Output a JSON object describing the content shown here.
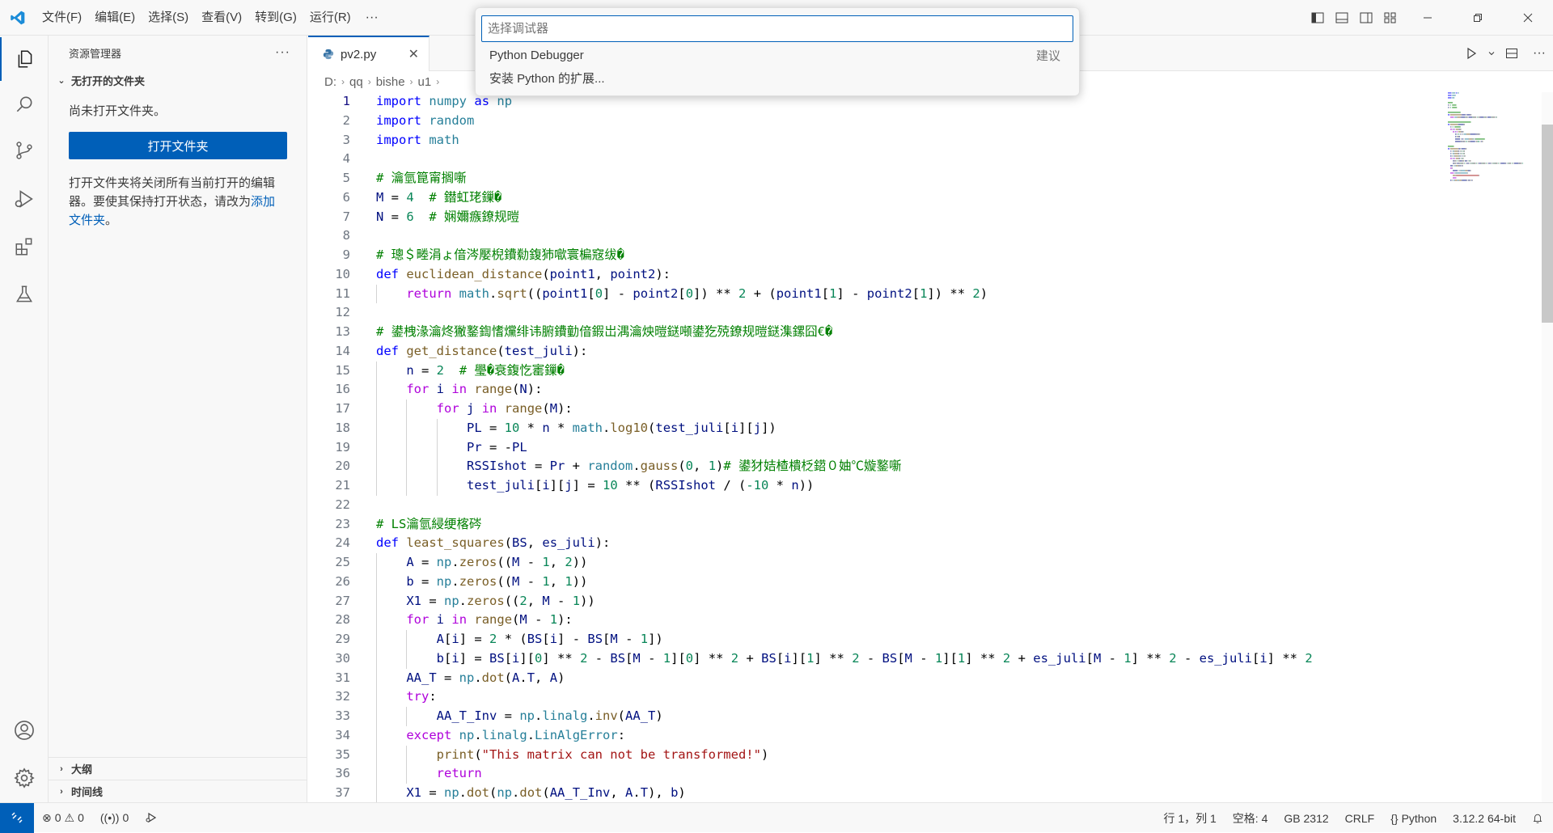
{
  "menu": [
    "文件(F)",
    "编辑(E)",
    "选择(S)",
    "查看(V)",
    "转到(G)",
    "运行(R)"
  ],
  "menu_more": "···",
  "quick_pick": {
    "placeholder": "选择调试器",
    "items": [
      {
        "label": "Python Debugger",
        "hint": "建议"
      },
      {
        "label": "安装 Python 的扩展...",
        "hint": ""
      }
    ]
  },
  "sidebar": {
    "title": "资源管理器",
    "more": "···",
    "section": "无打开的文件夹",
    "no_folder_text": "尚未打开文件夹。",
    "open_button": "打开文件夹",
    "description": "打开文件夹将关闭所有当前打开的编辑器。要使其保持打开状态，请改为",
    "add_link": "添加文件夹",
    "add_suffix": "。",
    "outline": "大纲",
    "timeline": "时间线"
  },
  "tab": {
    "label": "pv2.py",
    "close": "✕"
  },
  "breadcrumb": [
    "D:",
    "qq",
    "bishe",
    "u1"
  ],
  "code_lines": [
    [
      [
        "kw",
        "import"
      ],
      [
        "plain",
        " "
      ],
      [
        "cls",
        "numpy"
      ],
      [
        "plain",
        " "
      ],
      [
        "kw",
        "as"
      ],
      [
        "plain",
        " "
      ],
      [
        "cls",
        "np"
      ]
    ],
    [
      [
        "kw",
        "import"
      ],
      [
        "plain",
        " "
      ],
      [
        "cls",
        "random"
      ]
    ],
    [
      [
        "kw",
        "import"
      ],
      [
        "plain",
        " "
      ],
      [
        "cls",
        "math"
      ]
    ],
    [],
    [
      [
        "com",
        "# 瀹氫箟甯搁噺"
      ]
    ],
    [
      [
        "var",
        "M"
      ],
      [
        "plain",
        " = "
      ],
      [
        "num",
        "4"
      ],
      [
        "plain",
        "  "
      ],
      [
        "com",
        "# 鐟虹珯鏁�"
      ]
    ],
    [
      [
        "var",
        "N"
      ],
      [
        "plain",
        " = "
      ],
      [
        "num",
        "6"
      ],
      [
        "plain",
        "  "
      ],
      [
        "com",
        "# 娴嬭瘯鐐规暟"
      ]
    ],
    [],
    [
      [
        "com",
        "# 璁＄畻涓ょ偣涔嬮棿鐨勬鍑犻噷寰楄窛绂�"
      ]
    ],
    [
      [
        "kw",
        "def"
      ],
      [
        "plain",
        " "
      ],
      [
        "fn",
        "euclidean_distance"
      ],
      [
        "plain",
        "("
      ],
      [
        "var",
        "point1"
      ],
      [
        "plain",
        ", "
      ],
      [
        "var",
        "point2"
      ],
      [
        "plain",
        "):"
      ]
    ],
    [
      [
        "plain",
        "    "
      ],
      [
        "ctrl",
        "return"
      ],
      [
        "plain",
        " "
      ],
      [
        "cls",
        "math"
      ],
      [
        "plain",
        "."
      ],
      [
        "fn",
        "sqrt"
      ],
      [
        "plain",
        "(("
      ],
      [
        "var",
        "point1"
      ],
      [
        "plain",
        "["
      ],
      [
        "num",
        "0"
      ],
      [
        "plain",
        "] - "
      ],
      [
        "var",
        "point2"
      ],
      [
        "plain",
        "["
      ],
      [
        "num",
        "0"
      ],
      [
        "plain",
        "]) ** "
      ],
      [
        "num",
        "2"
      ],
      [
        "plain",
        " + ("
      ],
      [
        "var",
        "point1"
      ],
      [
        "plain",
        "["
      ],
      [
        "num",
        "1"
      ],
      [
        "plain",
        "] - "
      ],
      [
        "var",
        "point2"
      ],
      [
        "plain",
        "["
      ],
      [
        "num",
        "1"
      ],
      [
        "plain",
        "]) ** "
      ],
      [
        "num",
        "2"
      ],
      [
        "plain",
        ")"
      ]
    ],
    [],
    [
      [
        "com",
        "# 鍙栧湪瀹炵獙鐜鍧愭爣绯讳腑鐨勭偣鍜岀湡瀹炴暟鎹噸鍙犵殑鐐规暟鎹潗鏍囧€�"
      ]
    ],
    [
      [
        "kw",
        "def"
      ],
      [
        "plain",
        " "
      ],
      [
        "fn",
        "get_distance"
      ],
      [
        "plain",
        "("
      ],
      [
        "var",
        "test_juli"
      ],
      [
        "plain",
        "):"
      ]
    ],
    [
      [
        "plain",
        "    "
      ],
      [
        "var",
        "n"
      ],
      [
        "plain",
        " = "
      ],
      [
        "num",
        "2"
      ],
      [
        "plain",
        "  "
      ],
      [
        "com",
        "# 璺�衰鍑忔寚鏁�"
      ]
    ],
    [
      [
        "plain",
        "    "
      ],
      [
        "ctrl",
        "for"
      ],
      [
        "plain",
        " "
      ],
      [
        "var",
        "i"
      ],
      [
        "plain",
        " "
      ],
      [
        "ctrl",
        "in"
      ],
      [
        "plain",
        " "
      ],
      [
        "fn",
        "range"
      ],
      [
        "plain",
        "("
      ],
      [
        "var",
        "N"
      ],
      [
        "plain",
        "):"
      ]
    ],
    [
      [
        "plain",
        "        "
      ],
      [
        "ctrl",
        "for"
      ],
      [
        "plain",
        " "
      ],
      [
        "var",
        "j"
      ],
      [
        "plain",
        " "
      ],
      [
        "ctrl",
        "in"
      ],
      [
        "plain",
        " "
      ],
      [
        "fn",
        "range"
      ],
      [
        "plain",
        "("
      ],
      [
        "var",
        "M"
      ],
      [
        "plain",
        "):"
      ]
    ],
    [
      [
        "plain",
        "            "
      ],
      [
        "var",
        "PL"
      ],
      [
        "plain",
        " = "
      ],
      [
        "num",
        "10"
      ],
      [
        "plain",
        " * "
      ],
      [
        "var",
        "n"
      ],
      [
        "plain",
        " * "
      ],
      [
        "cls",
        "math"
      ],
      [
        "plain",
        "."
      ],
      [
        "fn",
        "log10"
      ],
      [
        "plain",
        "("
      ],
      [
        "var",
        "test_juli"
      ],
      [
        "plain",
        "["
      ],
      [
        "var",
        "i"
      ],
      [
        "plain",
        "]["
      ],
      [
        "var",
        "j"
      ],
      [
        "plain",
        "])"
      ]
    ],
    [
      [
        "plain",
        "            "
      ],
      [
        "var",
        "Pr"
      ],
      [
        "plain",
        " = -"
      ],
      [
        "var",
        "PL"
      ]
    ],
    [
      [
        "plain",
        "            "
      ],
      [
        "var",
        "RSSIshot"
      ],
      [
        "plain",
        " = "
      ],
      [
        "var",
        "Pr"
      ],
      [
        "plain",
        " + "
      ],
      [
        "cls",
        "random"
      ],
      [
        "plain",
        "."
      ],
      [
        "fn",
        "gauss"
      ],
      [
        "plain",
        "("
      ],
      [
        "num",
        "0"
      ],
      [
        "plain",
        ", "
      ],
      [
        "num",
        "1"
      ],
      [
        "plain",
        ")"
      ],
      [
        "com",
        "# 鍙犲姞楂樻柉鍣０妯℃嫙鐜噺"
      ]
    ],
    [
      [
        "plain",
        "            "
      ],
      [
        "var",
        "test_juli"
      ],
      [
        "plain",
        "["
      ],
      [
        "var",
        "i"
      ],
      [
        "plain",
        "]["
      ],
      [
        "var",
        "j"
      ],
      [
        "plain",
        "] = "
      ],
      [
        "num",
        "10"
      ],
      [
        "plain",
        " ** ("
      ],
      [
        "var",
        "RSSIshot"
      ],
      [
        "plain",
        " / ("
      ],
      [
        "num",
        "-10"
      ],
      [
        "plain",
        " * "
      ],
      [
        "var",
        "n"
      ],
      [
        "plain",
        "))"
      ]
    ],
    [],
    [
      [
        "com",
        "# LS瀹氫綅绠楁硶"
      ]
    ],
    [
      [
        "kw",
        "def"
      ],
      [
        "plain",
        " "
      ],
      [
        "fn",
        "least_squares"
      ],
      [
        "plain",
        "("
      ],
      [
        "var",
        "BS"
      ],
      [
        "plain",
        ", "
      ],
      [
        "var",
        "es_juli"
      ],
      [
        "plain",
        "):"
      ]
    ],
    [
      [
        "plain",
        "    "
      ],
      [
        "var",
        "A"
      ],
      [
        "plain",
        " = "
      ],
      [
        "cls",
        "np"
      ],
      [
        "plain",
        "."
      ],
      [
        "fn",
        "zeros"
      ],
      [
        "plain",
        "(("
      ],
      [
        "var",
        "M"
      ],
      [
        "plain",
        " - "
      ],
      [
        "num",
        "1"
      ],
      [
        "plain",
        ", "
      ],
      [
        "num",
        "2"
      ],
      [
        "plain",
        "))"
      ]
    ],
    [
      [
        "plain",
        "    "
      ],
      [
        "var",
        "b"
      ],
      [
        "plain",
        " = "
      ],
      [
        "cls",
        "np"
      ],
      [
        "plain",
        "."
      ],
      [
        "fn",
        "zeros"
      ],
      [
        "plain",
        "(("
      ],
      [
        "var",
        "M"
      ],
      [
        "plain",
        " - "
      ],
      [
        "num",
        "1"
      ],
      [
        "plain",
        ", "
      ],
      [
        "num",
        "1"
      ],
      [
        "plain",
        "))"
      ]
    ],
    [
      [
        "plain",
        "    "
      ],
      [
        "var",
        "X1"
      ],
      [
        "plain",
        " = "
      ],
      [
        "cls",
        "np"
      ],
      [
        "plain",
        "."
      ],
      [
        "fn",
        "zeros"
      ],
      [
        "plain",
        "(("
      ],
      [
        "num",
        "2"
      ],
      [
        "plain",
        ", "
      ],
      [
        "var",
        "M"
      ],
      [
        "plain",
        " - "
      ],
      [
        "num",
        "1"
      ],
      [
        "plain",
        "))"
      ]
    ],
    [
      [
        "plain",
        "    "
      ],
      [
        "ctrl",
        "for"
      ],
      [
        "plain",
        " "
      ],
      [
        "var",
        "i"
      ],
      [
        "plain",
        " "
      ],
      [
        "ctrl",
        "in"
      ],
      [
        "plain",
        " "
      ],
      [
        "fn",
        "range"
      ],
      [
        "plain",
        "("
      ],
      [
        "var",
        "M"
      ],
      [
        "plain",
        " - "
      ],
      [
        "num",
        "1"
      ],
      [
        "plain",
        "):"
      ]
    ],
    [
      [
        "plain",
        "        "
      ],
      [
        "var",
        "A"
      ],
      [
        "plain",
        "["
      ],
      [
        "var",
        "i"
      ],
      [
        "plain",
        "] = "
      ],
      [
        "num",
        "2"
      ],
      [
        "plain",
        " * ("
      ],
      [
        "var",
        "BS"
      ],
      [
        "plain",
        "["
      ],
      [
        "var",
        "i"
      ],
      [
        "plain",
        "] - "
      ],
      [
        "var",
        "BS"
      ],
      [
        "plain",
        "["
      ],
      [
        "var",
        "M"
      ],
      [
        "plain",
        " - "
      ],
      [
        "num",
        "1"
      ],
      [
        "plain",
        "])"
      ]
    ],
    [
      [
        "plain",
        "        "
      ],
      [
        "var",
        "b"
      ],
      [
        "plain",
        "["
      ],
      [
        "var",
        "i"
      ],
      [
        "plain",
        "] = "
      ],
      [
        "var",
        "BS"
      ],
      [
        "plain",
        "["
      ],
      [
        "var",
        "i"
      ],
      [
        "plain",
        "]["
      ],
      [
        "num",
        "0"
      ],
      [
        "plain",
        "] ** "
      ],
      [
        "num",
        "2"
      ],
      [
        "plain",
        " - "
      ],
      [
        "var",
        "BS"
      ],
      [
        "plain",
        "["
      ],
      [
        "var",
        "M"
      ],
      [
        "plain",
        " - "
      ],
      [
        "num",
        "1"
      ],
      [
        "plain",
        "]["
      ],
      [
        "num",
        "0"
      ],
      [
        "plain",
        "] ** "
      ],
      [
        "num",
        "2"
      ],
      [
        "plain",
        " + "
      ],
      [
        "var",
        "BS"
      ],
      [
        "plain",
        "["
      ],
      [
        "var",
        "i"
      ],
      [
        "plain",
        "]["
      ],
      [
        "num",
        "1"
      ],
      [
        "plain",
        "] ** "
      ],
      [
        "num",
        "2"
      ],
      [
        "plain",
        " - "
      ],
      [
        "var",
        "BS"
      ],
      [
        "plain",
        "["
      ],
      [
        "var",
        "M"
      ],
      [
        "plain",
        " - "
      ],
      [
        "num",
        "1"
      ],
      [
        "plain",
        "]["
      ],
      [
        "num",
        "1"
      ],
      [
        "plain",
        "] ** "
      ],
      [
        "num",
        "2"
      ],
      [
        "plain",
        " + "
      ],
      [
        "var",
        "es_juli"
      ],
      [
        "plain",
        "["
      ],
      [
        "var",
        "M"
      ],
      [
        "plain",
        " - "
      ],
      [
        "num",
        "1"
      ],
      [
        "plain",
        "] ** "
      ],
      [
        "num",
        "2"
      ],
      [
        "plain",
        " - "
      ],
      [
        "var",
        "es_juli"
      ],
      [
        "plain",
        "["
      ],
      [
        "var",
        "i"
      ],
      [
        "plain",
        "] ** "
      ],
      [
        "num",
        "2"
      ]
    ],
    [
      [
        "plain",
        "    "
      ],
      [
        "var",
        "AA_T"
      ],
      [
        "plain",
        " = "
      ],
      [
        "cls",
        "np"
      ],
      [
        "plain",
        "."
      ],
      [
        "fn",
        "dot"
      ],
      [
        "plain",
        "("
      ],
      [
        "var",
        "A"
      ],
      [
        "plain",
        "."
      ],
      [
        "var",
        "T"
      ],
      [
        "plain",
        ", "
      ],
      [
        "var",
        "A"
      ],
      [
        "plain",
        ")"
      ]
    ],
    [
      [
        "plain",
        "    "
      ],
      [
        "ctrl",
        "try"
      ],
      [
        "plain",
        ":"
      ]
    ],
    [
      [
        "plain",
        "        "
      ],
      [
        "var",
        "AA_T_Inv"
      ],
      [
        "plain",
        " = "
      ],
      [
        "cls",
        "np"
      ],
      [
        "plain",
        "."
      ],
      [
        "cls",
        "linalg"
      ],
      [
        "plain",
        "."
      ],
      [
        "fn",
        "inv"
      ],
      [
        "plain",
        "("
      ],
      [
        "var",
        "AA_T"
      ],
      [
        "plain",
        ")"
      ]
    ],
    [
      [
        "plain",
        "    "
      ],
      [
        "ctrl",
        "except"
      ],
      [
        "plain",
        " "
      ],
      [
        "cls",
        "np"
      ],
      [
        "plain",
        "."
      ],
      [
        "cls",
        "linalg"
      ],
      [
        "plain",
        "."
      ],
      [
        "cls",
        "LinAlgError"
      ],
      [
        "plain",
        ":"
      ]
    ],
    [
      [
        "plain",
        "        "
      ],
      [
        "fn",
        "print"
      ],
      [
        "plain",
        "("
      ],
      [
        "str",
        "\"This matrix can not be transformed!\""
      ],
      [
        "plain",
        ")"
      ]
    ],
    [
      [
        "plain",
        "        "
      ],
      [
        "ctrl",
        "return"
      ]
    ],
    [
      [
        "plain",
        "    "
      ],
      [
        "var",
        "X1"
      ],
      [
        "plain",
        " = "
      ],
      [
        "cls",
        "np"
      ],
      [
        "plain",
        "."
      ],
      [
        "fn",
        "dot"
      ],
      [
        "plain",
        "("
      ],
      [
        "cls",
        "np"
      ],
      [
        "plain",
        "."
      ],
      [
        "fn",
        "dot"
      ],
      [
        "plain",
        "("
      ],
      [
        "var",
        "AA_T_Inv"
      ],
      [
        "plain",
        ", "
      ],
      [
        "var",
        "A"
      ],
      [
        "plain",
        "."
      ],
      [
        "var",
        "T"
      ],
      [
        "plain",
        "), "
      ],
      [
        "var",
        "b"
      ],
      [
        "plain",
        ")"
      ]
    ]
  ],
  "status": {
    "errors": "0",
    "warnings": "0",
    "ports": "0",
    "position": "行 1，列 1",
    "spaces": "空格: 4",
    "encoding": "GB 2312",
    "eol": "CRLF",
    "language": "Python",
    "interpreter": "3.12.2 64-bit"
  },
  "colors": {
    "accent": "#005fb8",
    "keyword": "#0000ff",
    "control": "#af00db",
    "comment": "#008000",
    "number": "#098658",
    "string": "#a31515",
    "function": "#795e26",
    "class": "#267f99",
    "variable": "#001080"
  }
}
